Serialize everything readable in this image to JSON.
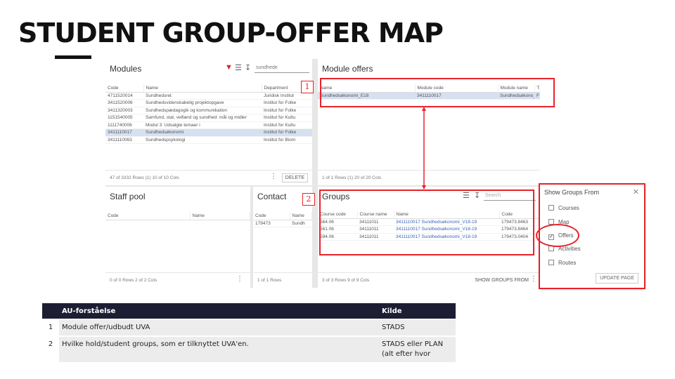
{
  "title": "STUDENT GROUP-OFFER MAP",
  "markers": {
    "one": "1",
    "two": "2"
  },
  "modules": {
    "title": "Modules",
    "search_value": "sundhede",
    "headers": [
      "Code",
      "Name",
      "Department"
    ],
    "rows": [
      [
        "4711520014",
        "Sundhedsret",
        "Juridisk Institut"
      ],
      [
        "3411520006",
        "Sundhedsvidenskabelig projektopgave",
        "Institut for Folke"
      ],
      [
        "3411320003",
        "Sundhedspædagogik og kommunikation",
        "Institut for Folke"
      ],
      [
        "1151540005",
        "Samfund, stat, velfærd og sundhed: mål og midler",
        "Institut for Kultu"
      ],
      [
        "1111740006",
        "Modul 3: Udvalgte temaer i",
        "Institut for Kultu"
      ],
      [
        "3411110017",
        "Sundhedsøkonomi",
        "Institut for Folke"
      ],
      [
        "3411110063",
        "Sundhedspsykologi",
        "Institut for Biom"
      ]
    ],
    "footer": "47 of 3332 Rows (1)   10 of 10 Cols",
    "delete_label": "DELETE"
  },
  "offers": {
    "title": "Module offers",
    "headers": [
      "Name",
      "Module code",
      "Module name",
      "Time"
    ],
    "rows": [
      [
        "Sundhedsøkonomi_E18",
        "3411110017",
        "Sundhedsøkono_133",
        "F"
      ]
    ],
    "footer": "1 of 1 Rows (1)   20 of 20 Cols"
  },
  "staff": {
    "title": "Staff pool",
    "headers": [
      "Code",
      "Name"
    ],
    "footer": "0 of 0 Rows   2 of 2 Cols"
  },
  "contact": {
    "title": "Contact",
    "headers": [
      "Code",
      "Name"
    ],
    "rows": [
      [
        "179473",
        "Sundh"
      ]
    ],
    "footer": "1 of 1 Rows"
  },
  "groups": {
    "title": "Groups",
    "search_placeholder": "Search",
    "headers": [
      "Course code",
      "Course name",
      "Name",
      "Code"
    ],
    "rows": [
      [
        "564.06",
        "34111011",
        "3411110017 Sundhedsøkonomi_V18-19",
        "179473.8463"
      ],
      [
        "561.06",
        "34111011",
        "3411110017 Sundhedsøkonomi_V18-19",
        "179473.8464"
      ],
      [
        "594.06",
        "34111011",
        "3411110017 Sundhedsøkonomi_V18-19",
        "179473.0404"
      ]
    ],
    "footer": "3 of 3 Rows   9 of 9 Cols",
    "show_from_label": "SHOW GROUPS FROM"
  },
  "popup": {
    "title": "Show Groups From",
    "options": [
      {
        "label": "Courses",
        "checked": false
      },
      {
        "label": "Map",
        "checked": false
      },
      {
        "label": "Offers",
        "checked": true
      },
      {
        "label": "Activities",
        "checked": false
      },
      {
        "label": "Routes",
        "checked": false
      }
    ],
    "update_label": "UPDATE PAGE"
  },
  "info_table": {
    "headers": [
      "AU-forståelse",
      "Kilde"
    ],
    "rows": [
      {
        "num": "1",
        "desc": "Module offer/udbudt UVA",
        "source": "STADS"
      },
      {
        "num": "2",
        "desc": "Hvilke hold/student groups, som er tilknyttet UVA'en.",
        "source": "STADS eller PLAN (alt efter hvor"
      }
    ]
  },
  "colors": {
    "accent_red": "#e8222a",
    "header_dark": "#1d1d33",
    "selected_row": "#d6e0f1",
    "link_blue": "#3b63b6"
  }
}
